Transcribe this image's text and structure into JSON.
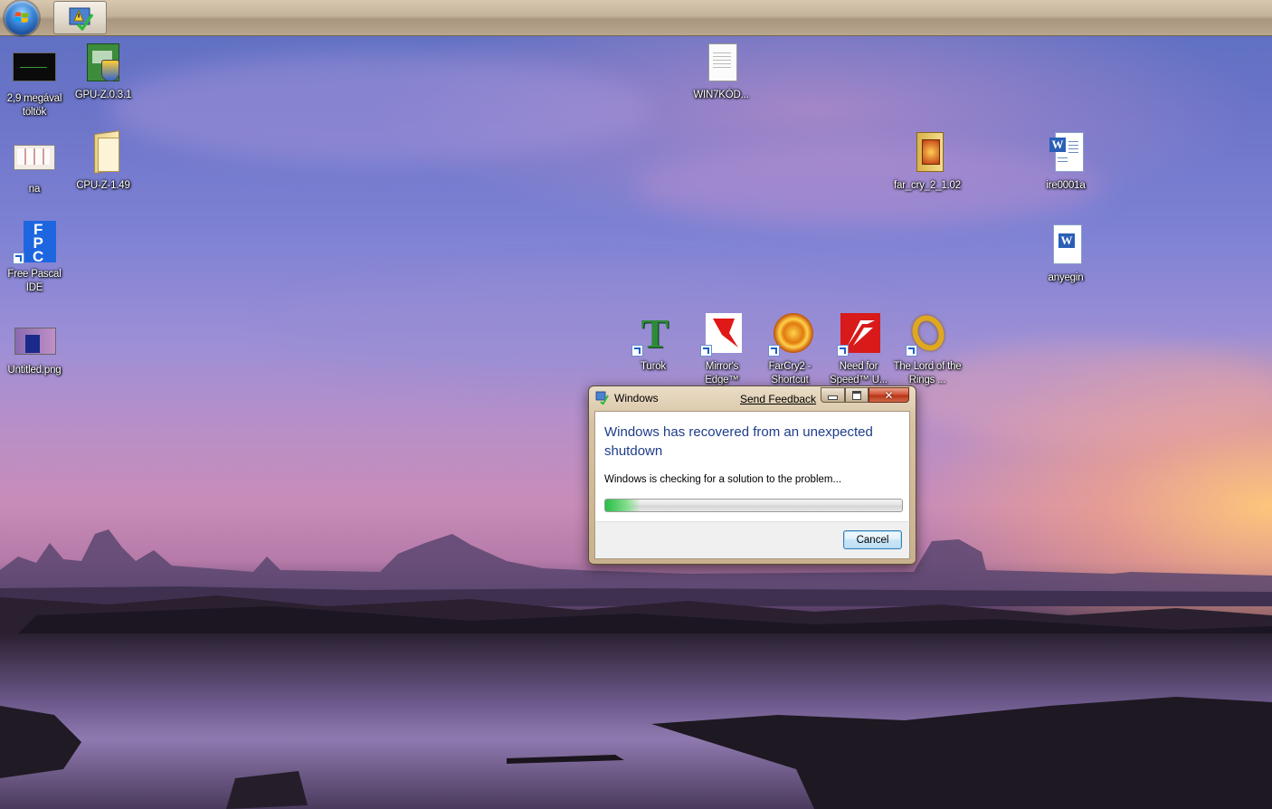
{
  "taskbar": {
    "start_icon": "windows-orb-icon",
    "tasks": [
      {
        "icon": "problem-reports-icon"
      }
    ]
  },
  "desktop": {
    "icons": [
      {
        "label": "2,9 megával töltök",
        "icon": "video-thumbnail-icon"
      },
      {
        "label": "GPU-Z.0.3.1",
        "icon": "gpu-z-installer-icon"
      },
      {
        "label": "WIN7KÓD...",
        "icon": "text-document-icon"
      },
      {
        "label": "na",
        "icon": "image-thumbnail-icon"
      },
      {
        "label": "CPU-Z-1.49",
        "icon": "folder-icon"
      },
      {
        "label": "far_cry_2_1.02",
        "icon": "archive-icon"
      },
      {
        "label": "ire0001a",
        "icon": "word-document-icon"
      },
      {
        "label": "Free Pascal IDE",
        "icon": "free-pascal-icon"
      },
      {
        "label": "anyegin",
        "icon": "word-document-icon"
      },
      {
        "label": "Untitled.png",
        "icon": "png-image-icon"
      },
      {
        "label": "Turok",
        "icon": "turok-game-icon"
      },
      {
        "label": "Mirror's Edge™",
        "icon": "mirrors-edge-icon"
      },
      {
        "label": "FarCry2 - Shortcut",
        "icon": "farcry2-icon"
      },
      {
        "label": "Need for Speed™ U...",
        "icon": "need-for-speed-icon"
      },
      {
        "label": "The Lord of the Rings ...",
        "icon": "lord-of-the-rings-icon"
      }
    ]
  },
  "dialog": {
    "title": "Windows",
    "send_feedback": "Send Feedback",
    "heading": "Windows has recovered from an unexpected shutdown",
    "message": "Windows is checking for a solution to the problem...",
    "progress_fraction": 0.12,
    "cancel_label": "Cancel",
    "controls": {
      "minimize": "minimize-icon",
      "maximize": "maximize-icon",
      "close": "close-icon"
    }
  },
  "colors": {
    "heading": "#1e3d8a",
    "progress": "#28be46"
  }
}
